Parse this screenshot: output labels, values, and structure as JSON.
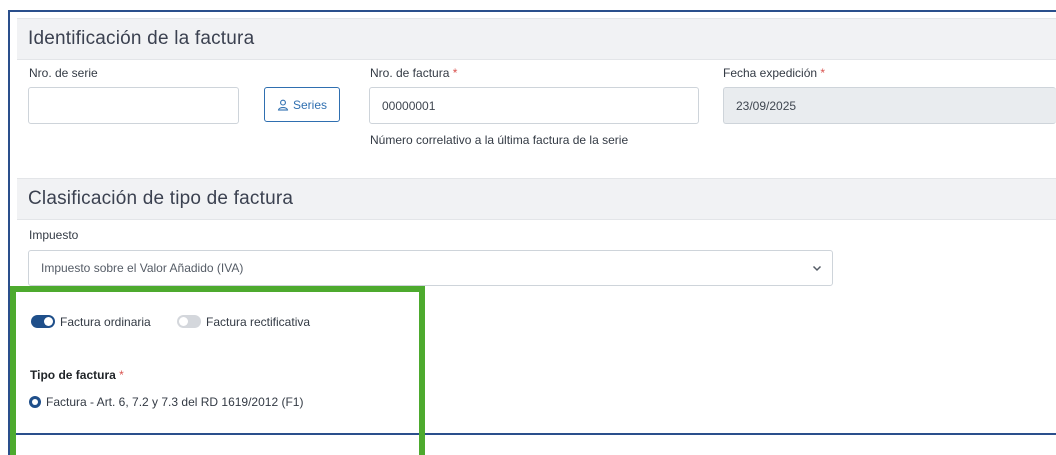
{
  "identificacion": {
    "title": "Identificación de la factura",
    "serie_label": "Nro. de serie",
    "serie_value": "",
    "series_button": "Series",
    "factura_label": "Nro. de factura",
    "factura_value": "00000001",
    "factura_help": "Número correlativo a la última factura de la serie",
    "fecha_label": "Fecha expedición",
    "fecha_value": "23/09/2025",
    "required_mark": "*"
  },
  "clasificacion": {
    "title": "Clasificación de tipo de factura",
    "impuesto_label": "Impuesto",
    "impuesto_value": "Impuesto sobre el Valor Añadido (IVA)",
    "toggle_ordinaria": "Factura ordinaria",
    "toggle_ordinaria_on": true,
    "toggle_rectificativa": "Factura rectificativa",
    "toggle_rectificativa_on": false,
    "tipo_label": "Tipo de factura",
    "tipo_option": "Factura - Art. 6, 7.2 y 7.3 del RD 1619/2012 (F1)"
  },
  "colors": {
    "accent": "#1f4f8a",
    "highlight": "#4daa2e",
    "required": "#d9534f"
  },
  "icons": {
    "series_button_icon": "user-icon",
    "select_icon": "chevron-down-icon"
  }
}
